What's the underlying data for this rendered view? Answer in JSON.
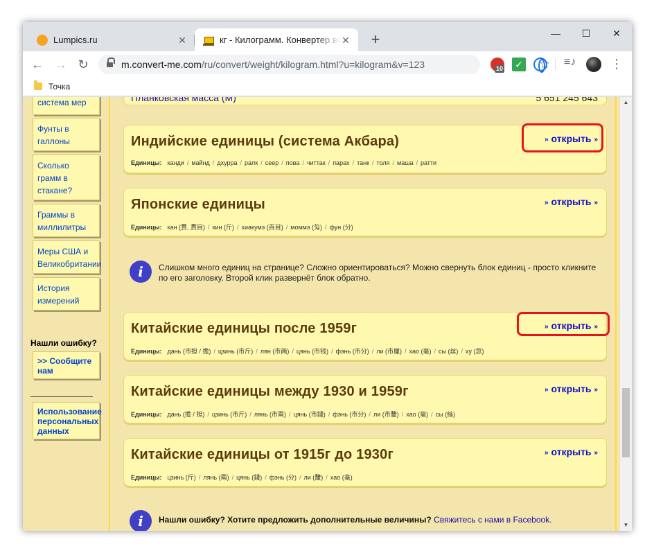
{
  "browser": {
    "tabs": [
      {
        "title": "Lumpics.ru",
        "icon": "orange-circle-icon"
      },
      {
        "title": "кг - Килограмм. Конвертер величин",
        "icon": "scale-icon"
      }
    ],
    "url_host": "m.convert-me.com",
    "url_path": "/ru/convert/weight/kilogram.html?u=kilogram&v=123",
    "extension_badge": "10",
    "bookmark": "Точка"
  },
  "sidebar": {
    "items": [
      {
        "lines": [
          "система мер"
        ]
      },
      {
        "lines": [
          "Фунты в",
          "галлоны"
        ]
      },
      {
        "lines": [
          "Сколько",
          "грамм в",
          "стакане?"
        ]
      },
      {
        "lines": [
          "Граммы в",
          "миллилитры"
        ]
      },
      {
        "lines": [
          "Меры США и",
          "Великобритании"
        ]
      },
      {
        "lines": [
          "История",
          "измерений"
        ]
      }
    ],
    "error_heading": "Нашли ошибку?",
    "report": [
      ">> Сообщите",
      "нам"
    ],
    "privacy": [
      "Использование",
      "персональных",
      "данных"
    ]
  },
  "partial_row": {
    "label": "Планковская масса (M)",
    "value": "5 651 245 643"
  },
  "open_label": "открыть",
  "units_label": "Единицы:",
  "sections": [
    {
      "title": "Индийские единицы (система Акбара)",
      "units": [
        "канди",
        "майнд",
        "дхурра",
        "ралк",
        "сеер",
        "пова",
        "читтак",
        "парах",
        "танк",
        "толя",
        "маша",
        "ратти"
      ]
    },
    {
      "title": "Японские единицы",
      "units": [
        "кан (貫, 貫目)",
        "кин (斤)",
        "хиакумэ (百目)",
        "моммэ (匁)",
        "фун (分)"
      ]
    },
    {
      "title": "Китайские единицы после 1959г",
      "units": [
        "дань (市担 / 擔)",
        "цзинь (市斤)",
        "лян (市两)",
        "цянь (市钱)",
        "фэнь (市分)",
        "ли (市厘)",
        "хао (毫)",
        "сы (丝)",
        "ху (忽)"
      ]
    },
    {
      "title": "Китайские единицы между 1930 и 1959г",
      "units": [
        "дань (擔 / 担)",
        "цзинь (市斤)",
        "лянь (市兩)",
        "цянь (市錢)",
        "фэнь (市分)",
        "ли (市釐)",
        "хао (毫)",
        "сы (絲)"
      ]
    },
    {
      "title": "Китайские единицы от 1915г до 1930г",
      "units": [
        "цзинь (斤)",
        "лянь (兩)",
        "цянь (錢)",
        "фэнь (分)",
        "ли (釐)",
        "хао (毫)"
      ]
    }
  ],
  "info1": "Слишком много единиц на странице? Сложно ориентироваться? Можно свернуть блок единиц - просто кликните по его заголовку. Второй клик развернёт блок обратно.",
  "info2": {
    "bold": "Нашли ошибку? Хотите предложить дополнительные величины?",
    "link": "Свяжитесь с нами в Facebook."
  },
  "colors": {
    "highlight": "#e8121b",
    "link": "#1010c8",
    "card": "#fff9b0",
    "page_bg": "#f3e5ab"
  }
}
